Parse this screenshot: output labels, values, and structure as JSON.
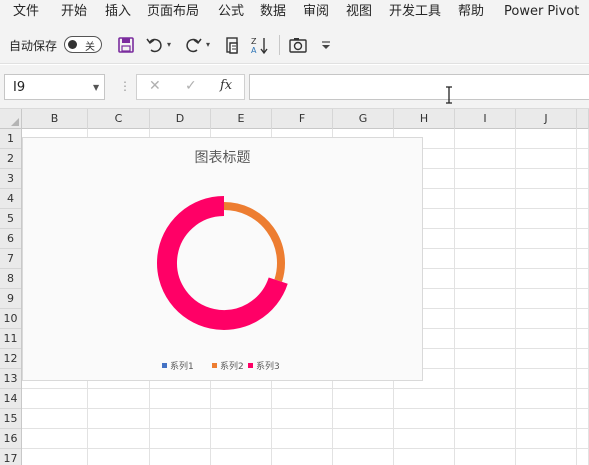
{
  "menu": [
    "文件",
    "开始",
    "插入",
    "页面布局",
    "公式",
    "数据",
    "审阅",
    "视图",
    "开发工具",
    "帮助",
    "Power Pivot"
  ],
  "toolbar": {
    "autosave_label": "自动保存",
    "autosave_state": "关",
    "icons": [
      "save-icon",
      "undo-icon",
      "redo-icon",
      "clipboard-icon",
      "sort-az-icon",
      "camera-icon",
      "customize-caret-icon"
    ]
  },
  "formula_bar": {
    "name_box": "I9",
    "dots": "⋮",
    "cancel_glyph": "✕",
    "confirm_glyph": "✓",
    "fx_label": "fx",
    "formula": ""
  },
  "sheet": {
    "columns": [
      "B",
      "C",
      "D",
      "E",
      "F",
      "G",
      "H",
      "I",
      "J"
    ],
    "rows": [
      "1",
      "2",
      "3",
      "4",
      "5",
      "6",
      "7",
      "8",
      "9",
      "10",
      "11",
      "12",
      "13",
      "14",
      "15",
      "16",
      "17"
    ]
  },
  "chart_data": {
    "type": "pie",
    "variant": "doughnut",
    "title": "图表标题",
    "categories": [
      "系列1",
      "系列2",
      "系列3"
    ],
    "values": [
      0,
      30,
      70
    ],
    "colors": [
      "#4472c4",
      "#ed7d31",
      "#ff0066"
    ],
    "legend_position": "bottom"
  }
}
